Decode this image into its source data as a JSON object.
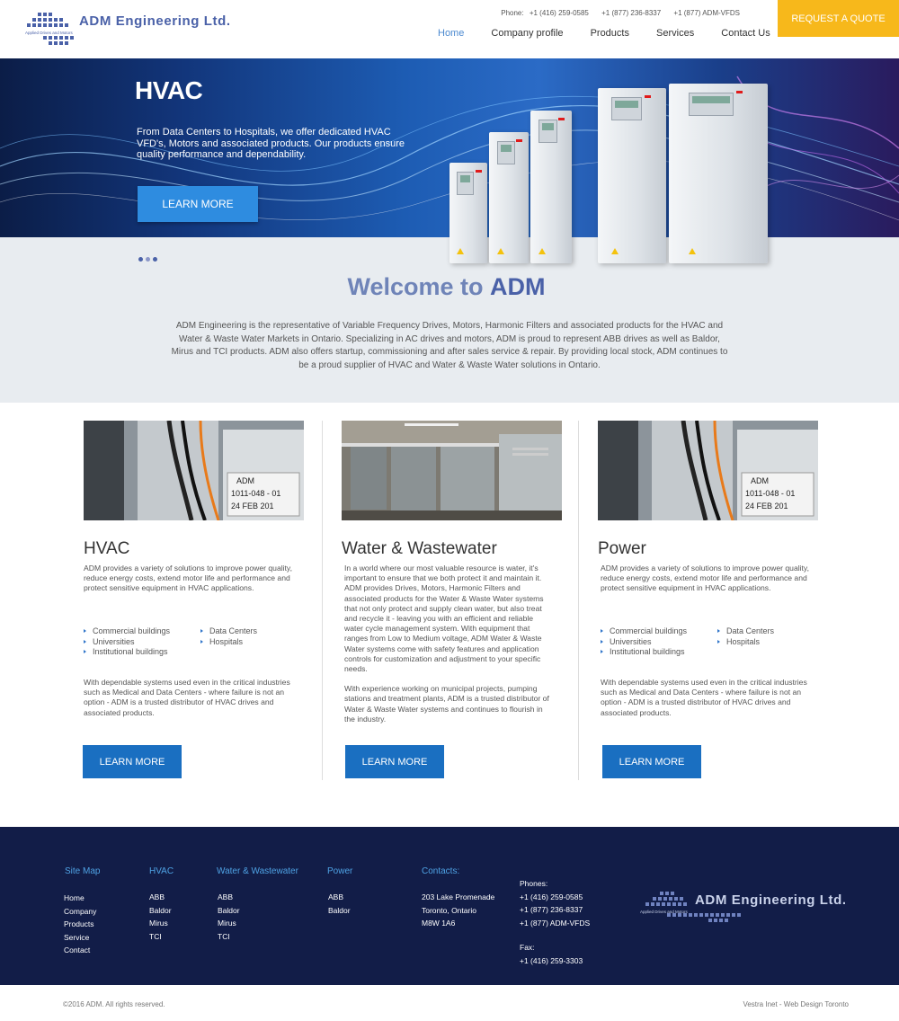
{
  "header": {
    "logo_text": "ADM Engineering Ltd.",
    "logo_sub": "Applied Drives and Motors",
    "phone_label": "Phone:",
    "phones": [
      "+1 (416) 259-0585",
      "+1 (877) 236-8337",
      "+1 (877) ADM-VFDS"
    ],
    "nav": [
      "Home",
      "Company profile",
      "Products",
      "Services",
      "Contact Us"
    ],
    "active_nav": "Home",
    "quote_button": "REQUEST A QUOTE"
  },
  "hero": {
    "title": "HVAC",
    "text": "From Data Centers to Hospitals, we offer dedicated HVAC VFD's, Motors and associated products. Our products ensure quality performance and dependability.",
    "button": "LEARN MORE"
  },
  "welcome": {
    "title_prefix": "Welcome to",
    "title_brand": "ADM",
    "text": "ADM Engineering is the representative of Variable Frequency Drives, Motors, Harmonic Filters and associated products for the HVAC and Water & Waste Water Markets in Ontario. Specializing in AC drives and motors, ADM is proud to represent ABB drives as well as Baldor, Mirus and TCI products. ADM also offers startup, commissioning and after sales service & repair. By providing local stock, ADM continues to be a proud supplier of HVAC and Water & Waste Water solutions in Ontario."
  },
  "columns": [
    {
      "title": "HVAC",
      "intro": "ADM provides a variety of solutions to improve power quality, reduce energy costs, extend motor life and performance and protect sensitive equipment in HVAC applications.",
      "list1": [
        "Commercial buildings",
        "Universities",
        "Institutional buildings"
      ],
      "list2": [
        "Data Centers",
        "Hospitals"
      ],
      "outro": "With dependable systems used even in the critical industries such as Medical and Data Centers - where failure is not an option - ADM is a trusted distributor of HVAC drives and associated products.",
      "image_label_1": "ADM",
      "image_label_2": "1011-048 - 01",
      "image_label_3": "24 FEB 201",
      "button": "LEARN MORE"
    },
    {
      "title": "Water & Wastewater",
      "p1": "In a world where our most valuable resource is water, it's important to ensure that we both protect it and maintain it. ADM provides Drives, Motors, Harmonic Filters and associated products for the Water & Waste Water systems that not only protect and supply clean water, but also treat and recycle it - leaving you with an efficient and reliable water cycle management system. With equipment that ranges from Low to Medium voltage, ADM Water & Waste Water systems come with safety features and application controls for customization and adjustment to your specific needs.",
      "p2": "With experience working on municipal projects, pumping stations and treatment plants, ADM is a trusted distributor of Water & Waste Water systems and continues to flourish in the industry.",
      "button": "LEARN MORE"
    },
    {
      "title": "Power",
      "intro": "ADM provides a variety of solutions to improve power quality, reduce energy costs, extend motor life and performance and protect sensitive equipment in HVAC applications.",
      "list1": [
        "Commercial buildings",
        "Universities",
        "Institutional buildings"
      ],
      "list2": [
        "Data Centers",
        "Hospitals"
      ],
      "outro": "With dependable systems used even in the critical industries such as Medical and Data Centers - where failure is not an option - ADM is a trusted distributor of HVAC drives and associated products.",
      "image_label_1": "ADM",
      "image_label_2": "1011-048 - 01",
      "image_label_3": "24 FEB 201",
      "button": "LEARN MORE"
    }
  ],
  "footer": {
    "sitemap": {
      "title": "Site Map",
      "items": [
        "Home",
        "Company",
        "Products",
        "Service",
        "Contact"
      ]
    },
    "hvac": {
      "title": "HVAC",
      "items": [
        "ABB",
        "Baldor",
        "Mirus",
        "TCI"
      ]
    },
    "water": {
      "title": "Water & Wastewater",
      "items": [
        "ABB",
        "Baldor",
        "Mirus",
        "TCI"
      ]
    },
    "power": {
      "title": "Power",
      "items": [
        "ABB",
        "Baldor"
      ]
    },
    "contacts": {
      "title": "Contacts:",
      "address": [
        "203 Lake Promenade",
        "Toronto, Ontario",
        "M8W 1A6"
      ]
    },
    "phones": {
      "label": "Phones:",
      "items": [
        "+1 (416) 259-0585",
        "+1 (877) 236-8337",
        "+1 (877) ADM-VFDS"
      ],
      "fax_label": "Fax:",
      "fax": "+1 (416) 259-3303"
    },
    "copyright": "©2016 ADM. All rights reserved.",
    "credit": "Vestra Inet - Web Design Toronto"
  },
  "colors": {
    "accent": "#f7b81b",
    "primary": "#1a6fc1",
    "brand": "#4a61a8",
    "footer_bg": "#121d48",
    "footer_head": "#4fa3e5"
  }
}
